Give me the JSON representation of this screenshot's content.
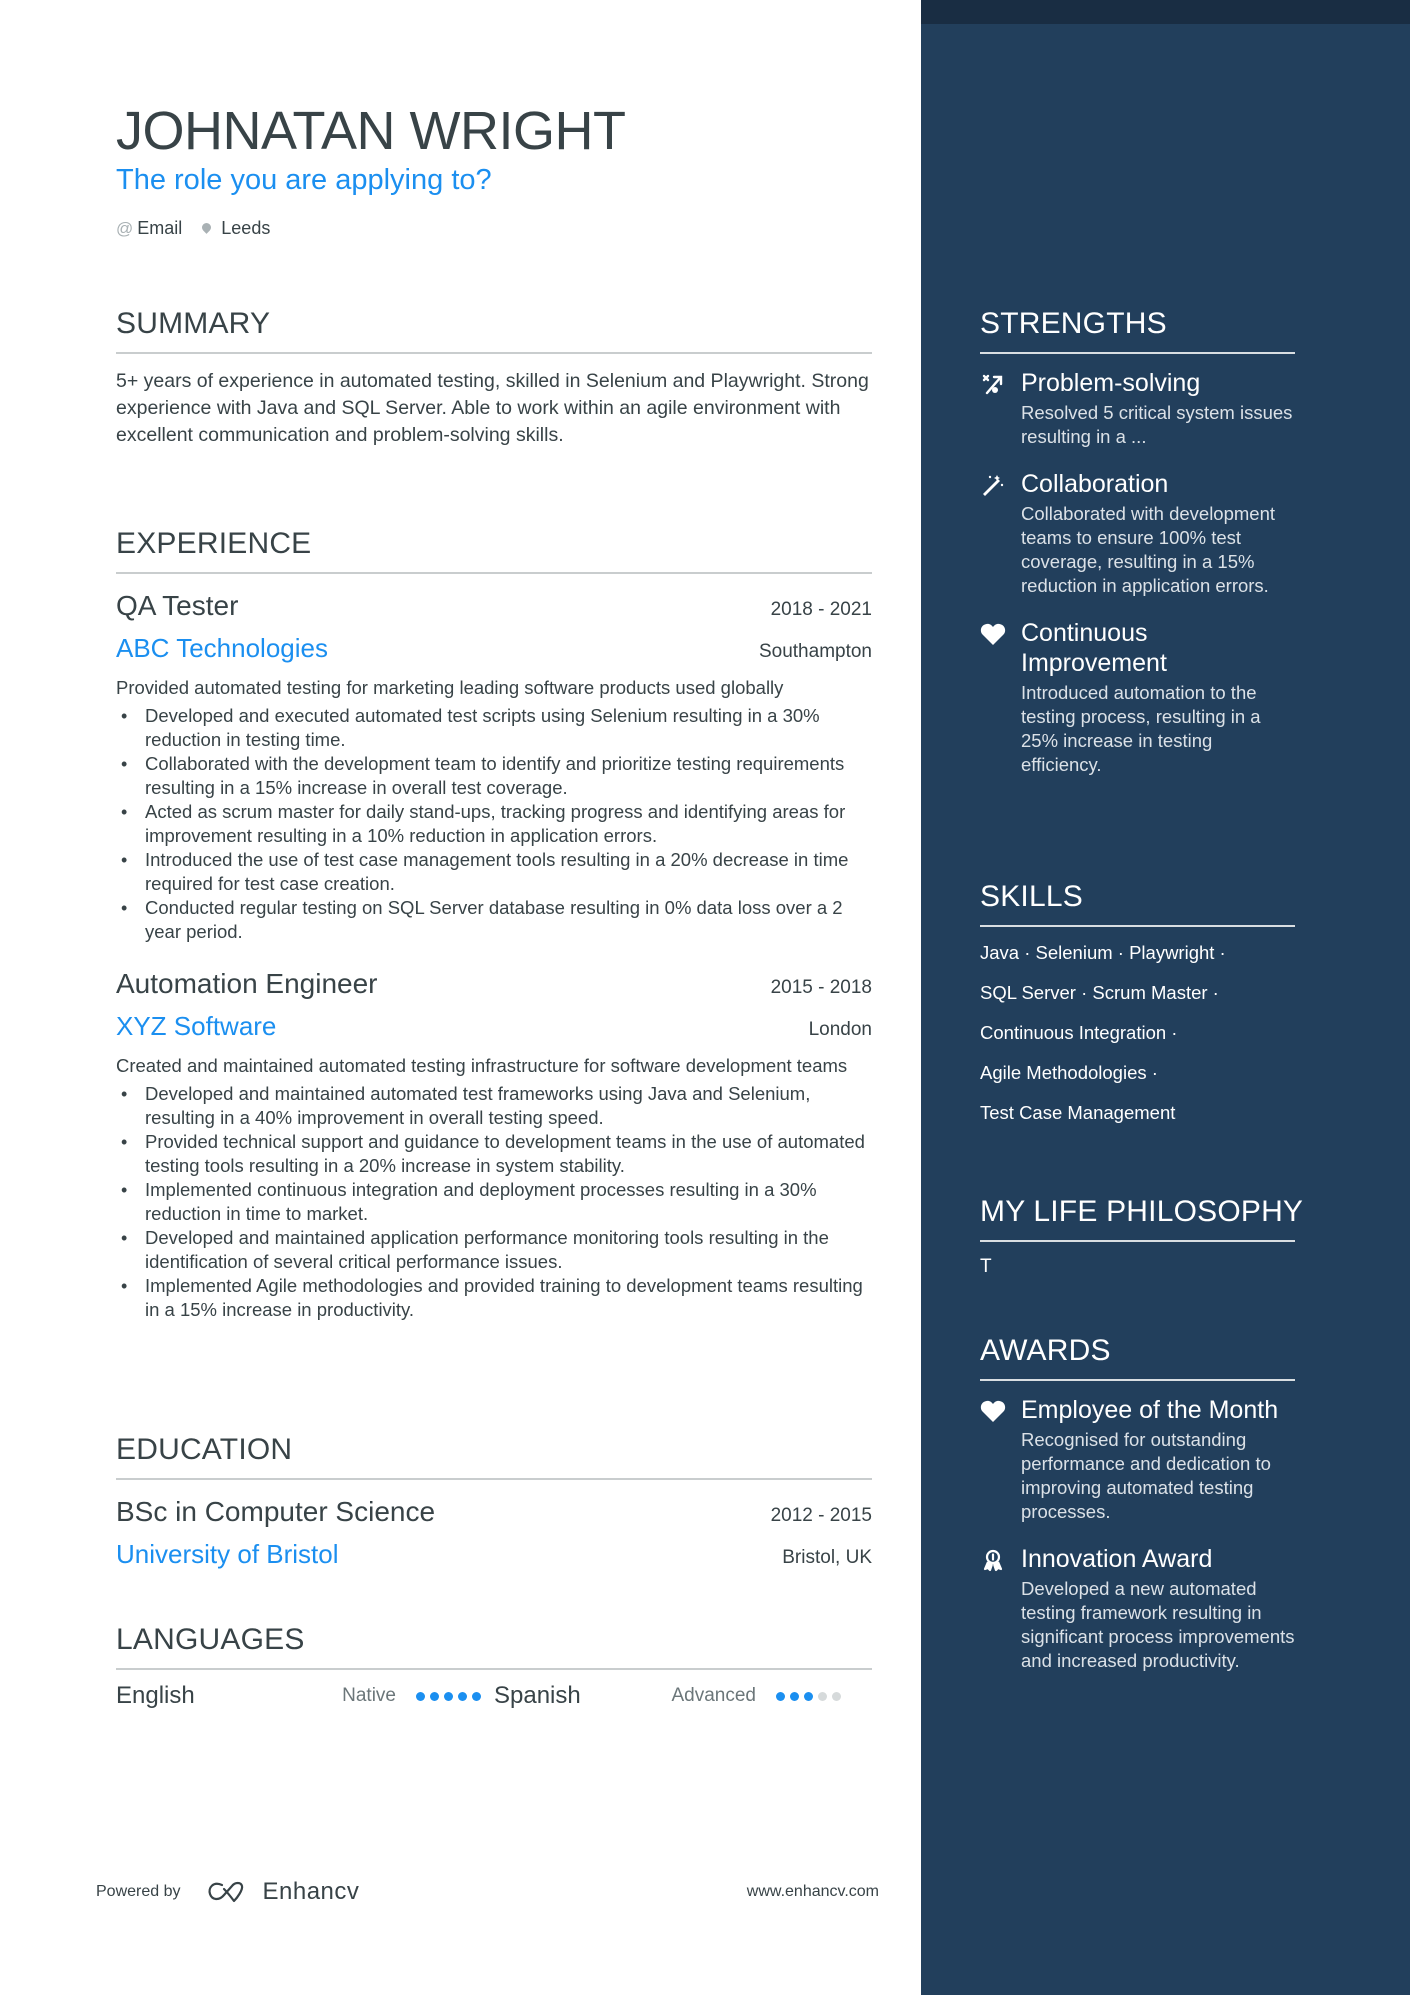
{
  "header": {
    "name": "JOHNATAN WRIGHT",
    "role": "The role you are applying to?",
    "contacts": [
      {
        "icon": "at-icon",
        "label": "Email"
      },
      {
        "icon": "location-pin-icon",
        "label": "Leeds"
      }
    ]
  },
  "summary": {
    "title": "SUMMARY",
    "text": "5+ years of experience in automated testing, skilled in Selenium and Playwright. Strong experience with Java and SQL Server. Able to work within an agile environment with excellent communication and problem-solving skills."
  },
  "experience": {
    "title": "EXPERIENCE",
    "jobs": [
      {
        "title": "QA Tester",
        "dates": "2018 - 2021",
        "company": "ABC Technologies",
        "location": "Southampton",
        "description": "Provided automated testing for marketing leading software products used globally",
        "bullets": [
          "Developed and executed automated test scripts using Selenium resulting in a 30% reduction in testing time.",
          "Collaborated with the development team to identify and prioritize testing requirements resulting in a 15% increase in overall test coverage.",
          "Acted as scrum master for daily stand-ups, tracking progress and identifying areas for improvement resulting in a 10% reduction in application errors.",
          "Introduced the use of test case management tools resulting in a 20% decrease in time required for test case creation.",
          "Conducted regular testing on SQL Server database resulting in 0% data loss over a 2 year period."
        ]
      },
      {
        "title": "Automation Engineer",
        "dates": "2015 - 2018",
        "company": "XYZ Software",
        "location": "London",
        "description": "Created and maintained automated testing infrastructure for software development teams",
        "bullets": [
          "Developed and maintained automated test frameworks using Java and Selenium, resulting in a 40% improvement in overall testing speed.",
          "Provided technical support and guidance to development teams in the use of automated testing tools resulting in a 20% increase in system stability.",
          "Implemented continuous integration and deployment processes resulting in a 30% reduction in time to market.",
          "Developed and maintained application performance monitoring tools resulting in the identification of several critical performance issues.",
          "Implemented Agile methodologies and provided training to development teams resulting in a 15% increase in productivity."
        ]
      }
    ]
  },
  "education": {
    "title": "EDUCATION",
    "entries": [
      {
        "degree": "BSc in Computer Science",
        "dates": "2012 - 2015",
        "school": "University of Bristol",
        "location": "Bristol, UK"
      }
    ]
  },
  "languages": {
    "title": "LANGUAGES",
    "items": [
      {
        "name": "English",
        "level": "Native",
        "rating": 5,
        "max": 5
      },
      {
        "name": "Spanish",
        "level": "Advanced",
        "rating": 3,
        "max": 5
      }
    ]
  },
  "footer": {
    "powered_by": "Powered by",
    "brand": "Enhancv",
    "website": "www.enhancv.com"
  },
  "strengths": {
    "title": "STRENGTHS",
    "items": [
      {
        "icon": "puzzle-arrow-icon",
        "title": "Problem-solving",
        "description": "Resolved 5 critical system issues resulting in a ..."
      },
      {
        "icon": "magic-wand-icon",
        "title": "Collaboration",
        "description": "Collaborated with development teams to ensure 100% test coverage, resulting in a 15% reduction in application errors."
      },
      {
        "icon": "heart-icon",
        "title": "Continuous Improvement",
        "description": "Introduced automation to the testing process, resulting in a 25% increase in testing efficiency."
      }
    ]
  },
  "skills": {
    "title": "SKILLS",
    "lines": [
      "Java · Selenium · Playwright ·",
      "SQL Server · Scrum Master ·",
      "Continuous Integration ·",
      "Agile Methodologies ·",
      "Test Case Management"
    ]
  },
  "philosophy": {
    "title": "MY LIFE PHILOSOPHY",
    "text": "T"
  },
  "awards": {
    "title": "AWARDS",
    "items": [
      {
        "icon": "heart-icon",
        "title": "Employee of the Month",
        "description": "Recognised for outstanding performance and dedication to improving automated testing processes."
      },
      {
        "icon": "award-ribbon-icon",
        "title": "Innovation Award",
        "description": "Developed a new automated testing framework resulting in significant process improvements and increased productivity."
      }
    ]
  },
  "colors": {
    "accent": "#1b8ff0",
    "text": "#384347",
    "sidebar_bg": "#223f5c",
    "sidebar_top": "#192d43"
  }
}
